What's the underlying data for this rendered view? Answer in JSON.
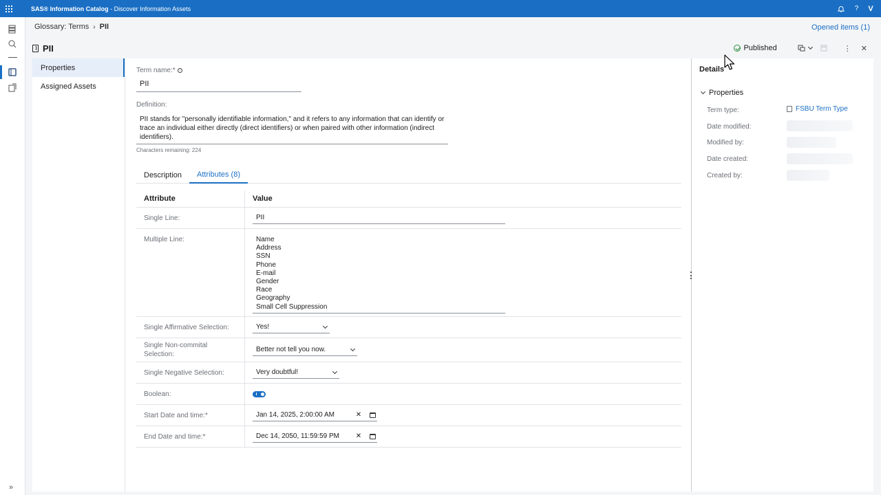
{
  "header": {
    "brand": "SAS® Information Catalog",
    "subtitle": " - Discover Information Assets",
    "user_initial": "V"
  },
  "breadcrumb": {
    "parent": "Glossary: Terms",
    "separator": "›",
    "current": "PII"
  },
  "opened_items": "Opened items (1)",
  "page": {
    "title": "PII",
    "status": "Published"
  },
  "nav": {
    "items": [
      "Properties",
      "Assigned Assets"
    ]
  },
  "form": {
    "term_name_label": "Term name:",
    "term_name_required": "*",
    "term_name_value": "PII",
    "definition_label": "Definition:",
    "definition_value": "PII stands for \"personally identifiable information,\" and it refers to any information that can identify or trace an individual either directly (direct identifiers) or when paired with other information (indirect identifiers).",
    "chars_remaining": "Characters remaining: 224"
  },
  "tabs": [
    "Description",
    "Attributes (8)"
  ],
  "attributes": {
    "header_attribute": "Attribute",
    "header_value": "Value",
    "single_line_label": "Single Line:",
    "single_line_value": "PII",
    "multiple_line_label": "Multiple Line:",
    "multiple_line_value": "Name\nAddress\nSSN\nPhone\nE-mail\nGender\nRace\nGeography\nSmall Cell Suppression",
    "affirmative_label": "Single Affirmative Selection:",
    "affirmative_value": "Yes!",
    "noncommital_label": "Single Non-commital Selection:",
    "noncommital_value": "Better not tell you now.",
    "negative_label": "Single Negative Selection:",
    "negative_value": "Very doubtful!",
    "boolean_label": "Boolean:",
    "start_label": "Start Date and time:",
    "start_required": "*",
    "start_value": "Jan 14, 2025, 2:00:00 AM",
    "end_label": "End Date and time:",
    "end_required": "*",
    "end_value": "Dec 14, 2050, 11:59:59 PM"
  },
  "details": {
    "title": "Details",
    "group": "Properties",
    "term_type_label": "Term type:",
    "term_type_value": "FSBU Term Type",
    "date_modified_label": "Date modified:",
    "modified_by_label": "Modified by:",
    "date_created_label": "Date created:",
    "created_by_label": "Created by:"
  },
  "colors": {
    "accent": "#1a6fc4",
    "published": "#2a8c3c"
  }
}
